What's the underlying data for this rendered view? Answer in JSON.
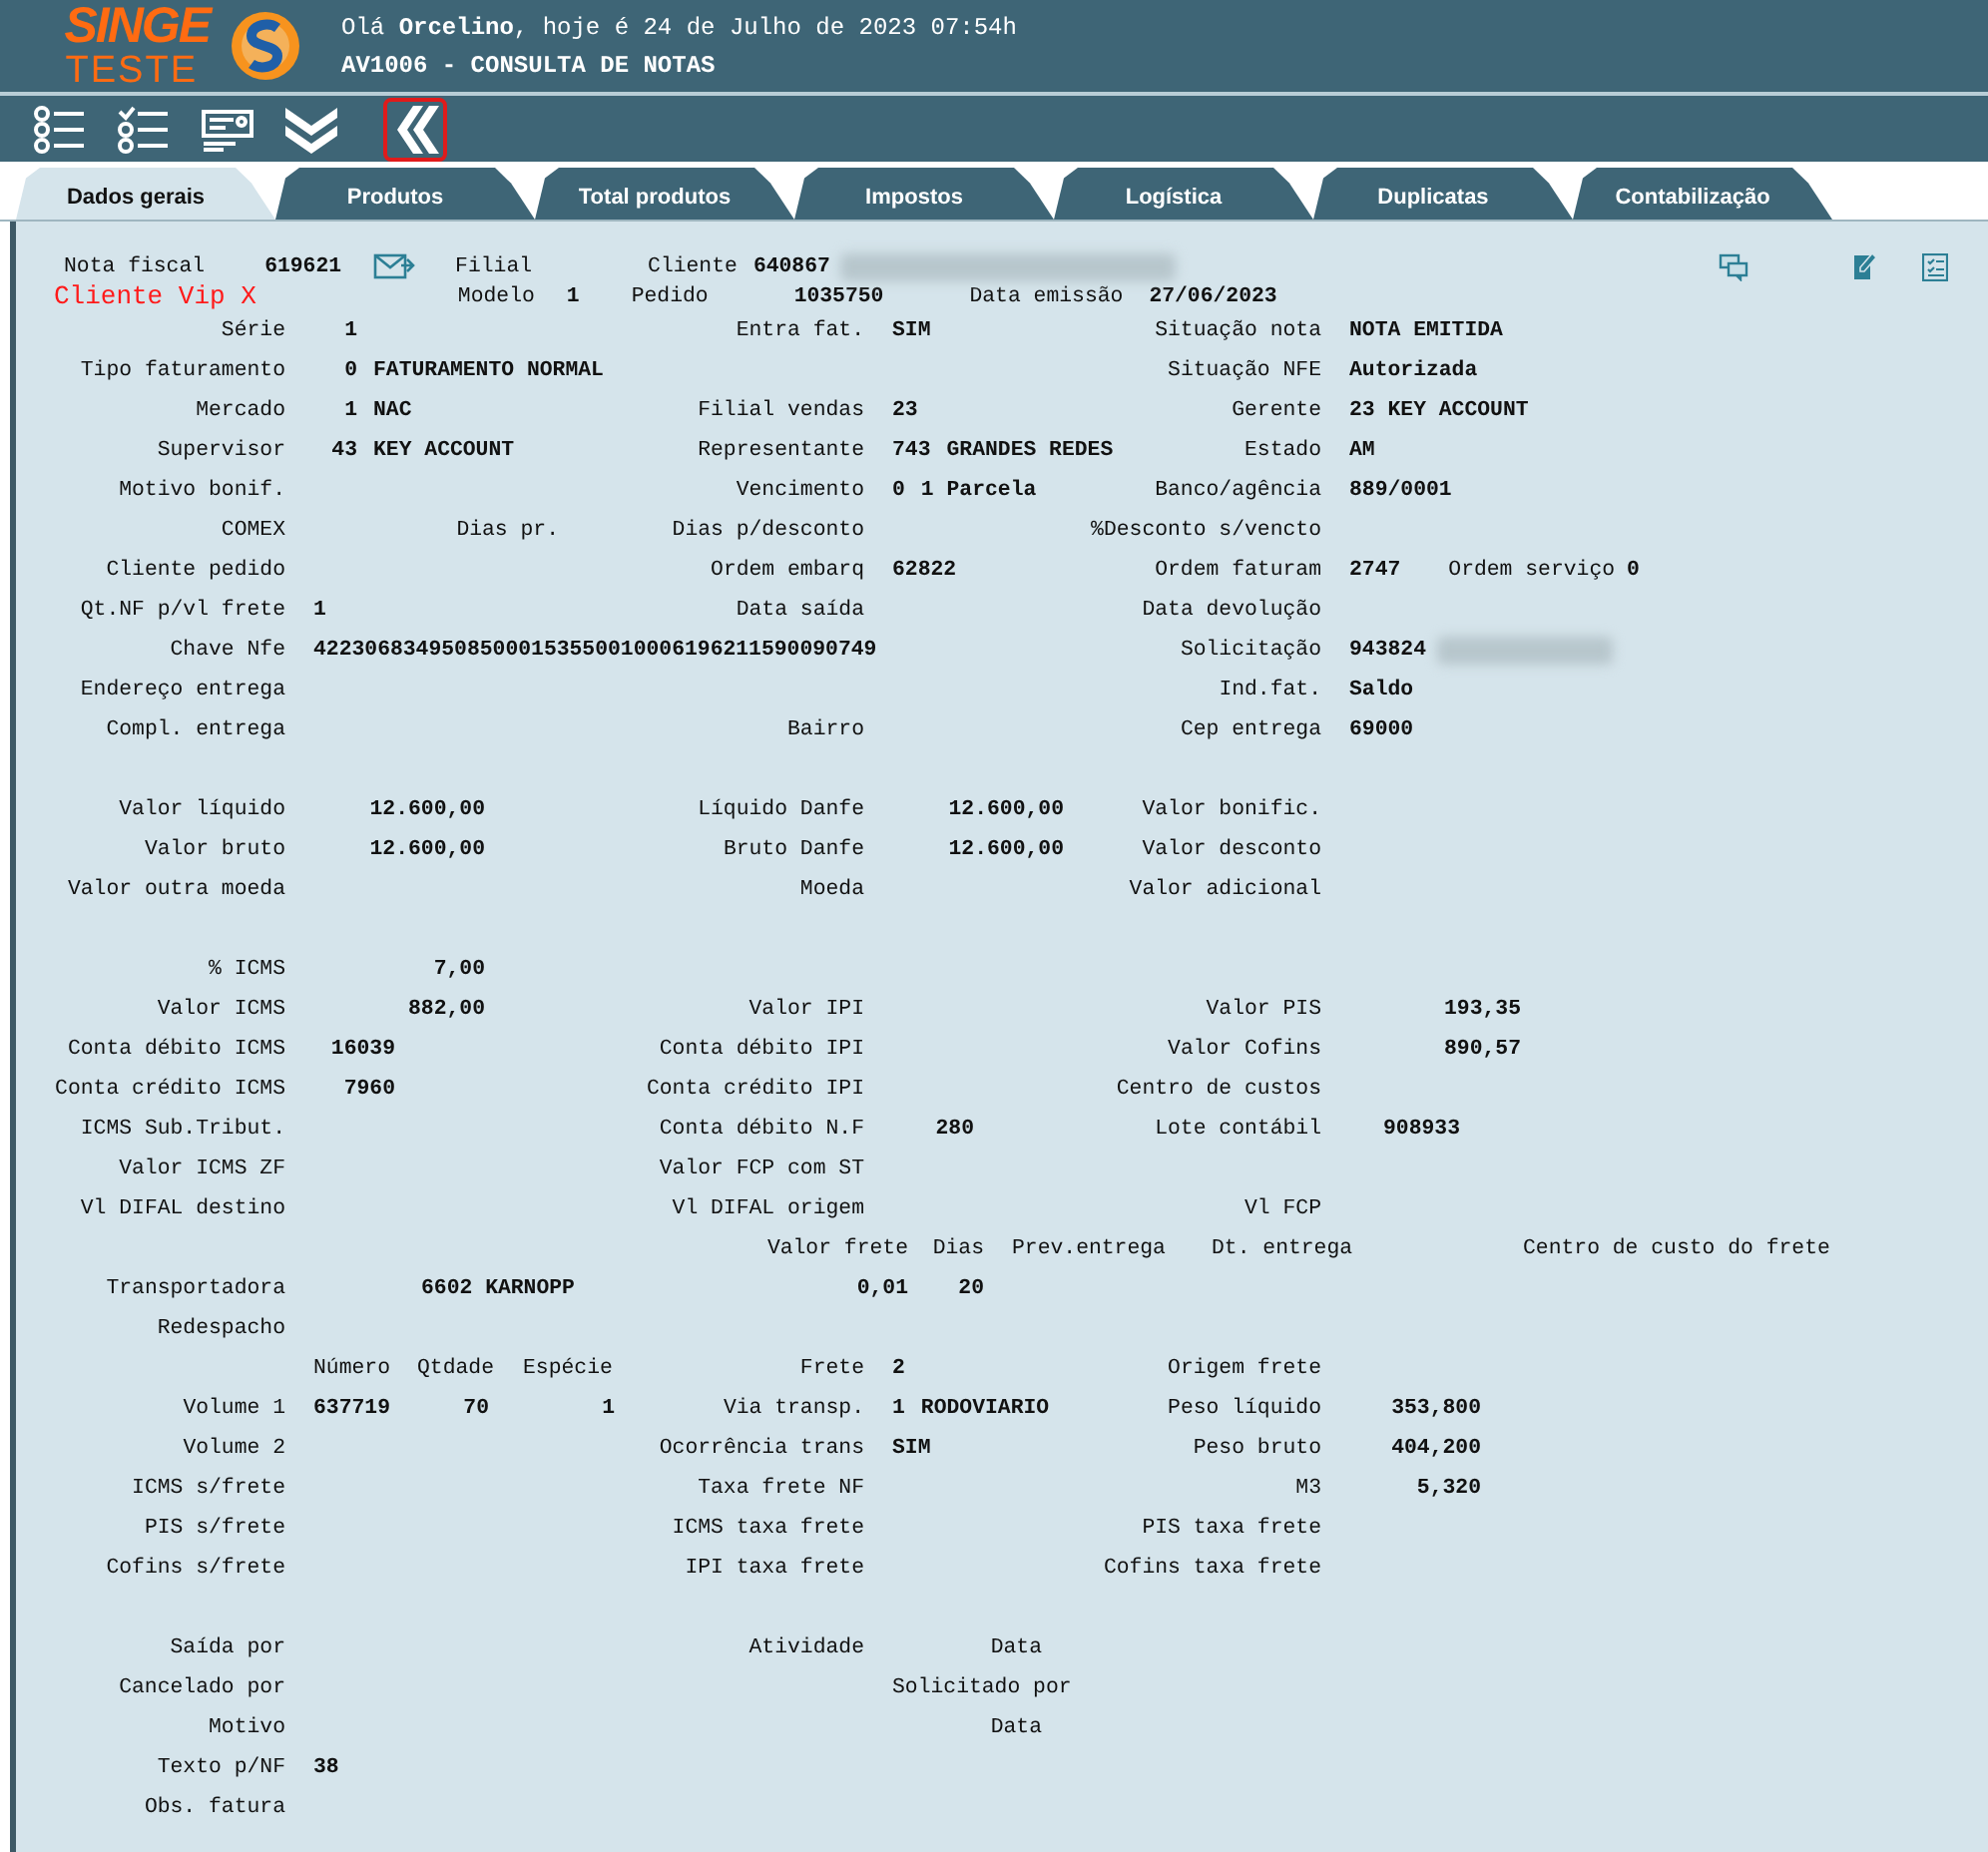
{
  "logo": {
    "name": "SINGE",
    "subtitle": "TESTE"
  },
  "greeting": "Olá **Orcelino**, hoje é 24 de Julho de 2023 07:54h",
  "title": "AV1006 - CONSULTA DE NOTAS",
  "toolbar": [
    {
      "kind": "list",
      "highlighted": false
    },
    {
      "kind": "checklist",
      "highlighted": false
    },
    {
      "kind": "card",
      "highlighted": false
    },
    {
      "kind": "chevrons-down",
      "highlighted": false
    },
    {
      "kind": "chevrons-left",
      "highlighted": true
    }
  ],
  "tabs": [
    {
      "label": "Dados gerais",
      "selected": true
    },
    {
      "label": "Produtos",
      "selected": false
    },
    {
      "label": "Total produtos",
      "selected": false
    },
    {
      "label": "Impostos",
      "selected": false
    },
    {
      "label": "Logística",
      "selected": false
    },
    {
      "label": "Duplicatas",
      "selected": false
    },
    {
      "label": "Contabilização",
      "selected": false
    }
  ],
  "header": {
    "nota_fiscal": {
      "label": "Nota fiscal",
      "value": "619621"
    },
    "filial": {
      "label": "Filial"
    },
    "cliente": {
      "label": "Cliente",
      "value": "640867",
      "redacted": true
    },
    "vip": "Cliente Vip X",
    "modelo": {
      "label": "Modelo",
      "value": "1"
    },
    "pedido": {
      "label": "Pedido",
      "value": "1035750"
    },
    "data_emissao": {
      "label": "Data emissão",
      "value": "27/06/2023"
    }
  },
  "sections": [
    {
      "rows": [
        {
          "cells": [
            {
              "label": "Série",
              "value": [
                "1"
              ]
            },
            {
              "label": "Entra fat.",
              "value": "SIM"
            },
            {
              "label": "Situação nota",
              "value": "NOTA EMITIDA"
            }
          ]
        },
        {
          "cells": [
            {
              "label": "Tipo faturamento",
              "value": [
                "0",
                "FATURAMENTO NORMAL"
              ]
            },
            null,
            {
              "label": "Situação NFE",
              "value": "Autorizada"
            }
          ]
        },
        {
          "cells": [
            {
              "label": "Mercado",
              "value": [
                "1",
                "NAC"
              ]
            },
            {
              "label": "Filial vendas",
              "value": "23"
            },
            {
              "label": "Gerente",
              "value": "23 KEY ACCOUNT"
            }
          ]
        },
        {
          "cells": [
            {
              "label": "Supervisor",
              "value": [
                "43",
                "KEY ACCOUNT"
              ]
            },
            {
              "label": "Representante",
              "value": [
                "743",
                "GRANDES REDES"
              ]
            },
            {
              "label": "Estado",
              "value": "AM"
            }
          ]
        },
        {
          "cells": [
            {
              "label": "Motivo bonif."
            },
            {
              "label": "Vencimento",
              "value": [
                "0",
                "1 Parcela"
              ]
            },
            {
              "label": "Banco/agência",
              "value": "889/0001"
            }
          ]
        },
        {
          "cells": [
            {
              "label": "COMEX",
              "note": "Dias pr."
            },
            {
              "label": "Dias p/desconto"
            },
            {
              "label": "%Desconto s/vencto"
            }
          ]
        },
        {
          "cells": [
            {
              "label": "Cliente pedido"
            },
            {
              "label": "Ordem embarq",
              "value": "62822"
            },
            {
              "label": "Ordem faturam",
              "value": "2747",
              "extra": {
                "label": "Ordem serviço",
                "value": "0"
              }
            }
          ]
        },
        {
          "cells": [
            {
              "label": "Qt.NF p/vl frete",
              "value": "1"
            },
            {
              "label": "Data saída"
            },
            {
              "label": "Data devolução"
            }
          ]
        },
        {
          "cells": [
            {
              "label": "Chave Nfe",
              "value": "42230683495085000153550010006196211590090749"
            },
            null,
            {
              "label": "Solicitação",
              "value": "943824",
              "redacted": true
            }
          ]
        },
        {
          "cells": [
            {
              "label": "Endereço entrega"
            },
            null,
            {
              "label": "Ind.fat.",
              "value": "Saldo"
            }
          ]
        },
        {
          "cells": [
            {
              "label": "Compl. entrega"
            },
            {
              "label": "Bairro"
            },
            {
              "label": "Cep entrega",
              "value": "69000"
            }
          ]
        }
      ]
    },
    {
      "rows": [
        {
          "cells": [
            {
              "label": "Valor líquido",
              "value": "12.600,00",
              "kind": "amount"
            },
            {
              "label": "Líquido Danfe",
              "value": "12.600,00",
              "kind": "amount"
            },
            {
              "label": "Valor bonific."
            }
          ]
        },
        {
          "cells": [
            {
              "label": "Valor bruto",
              "value": "12.600,00",
              "kind": "amount"
            },
            {
              "label": "Bruto Danfe",
              "value": "12.600,00",
              "kind": "amount"
            },
            {
              "label": "Valor desconto"
            }
          ]
        },
        {
          "cells": [
            {
              "label": "Valor outra moeda"
            },
            {
              "label": "Moeda"
            },
            {
              "label": "Valor adicional"
            }
          ]
        }
      ]
    },
    {
      "rows": [
        {
          "cells": [
            {
              "label": "% ICMS",
              "value": "7,00",
              "kind": "amount"
            },
            null,
            null
          ]
        },
        {
          "cells": [
            {
              "label": "Valor ICMS",
              "value": "882,00",
              "kind": "amount"
            },
            {
              "label": "Valor IPI"
            },
            {
              "label": "Valor PIS",
              "value": "193,35",
              "kind": "amount"
            }
          ]
        },
        {
          "cells": [
            {
              "label": "Conta débito ICMS",
              "value": "16039",
              "kind": "code"
            },
            {
              "label": "Conta débito IPI"
            },
            {
              "label": "Valor Cofins",
              "value": "890,57",
              "kind": "amount"
            }
          ]
        },
        {
          "cells": [
            {
              "label": "Conta crédito ICMS",
              "value": "7960",
              "kind": "code"
            },
            {
              "label": "Conta crédito IPI"
            },
            {
              "label": "Centro de custos"
            }
          ]
        },
        {
          "cells": [
            {
              "label": "ICMS Sub.Tribut."
            },
            {
              "label": "Conta débito N.F",
              "value": "280",
              "kind": "code"
            },
            {
              "label": "Lote contábil",
              "value": "908933",
              "kind": "lot"
            }
          ]
        },
        {
          "cells": [
            {
              "label": "Valor ICMS ZF"
            },
            {
              "label": "Valor FCP com ST"
            },
            null
          ]
        },
        {
          "cells": [
            {
              "label": "Vl DIFAL destino"
            },
            {
              "label": "Vl DIFAL origem"
            },
            {
              "label": "Vl FCP"
            }
          ]
        },
        {
          "kind": "freight_head",
          "columns": [
            "Valor frete",
            "Dias",
            "Prev.entrega",
            "Dt. entrega",
            "Centro de custo do frete"
          ]
        },
        {
          "kind": "carrier",
          "label": "Transportadora",
          "value": "6602 KARNOPP",
          "freight": "0,01",
          "days": "20"
        },
        {
          "cells": [
            {
              "label": "Redespacho"
            },
            null,
            null
          ]
        },
        {
          "cells": [
            {
              "columns": [
                "Número",
                "Qtdade",
                "Espécie"
              ]
            },
            {
              "label": "Frete",
              "value": "2"
            },
            {
              "label": "Origem frete"
            }
          ]
        },
        {
          "cells": [
            {
              "label": "Volume 1",
              "value": [
                "637719",
                "70",
                "1"
              ],
              "kind": "volume"
            },
            {
              "label": "Via transp.",
              "value": [
                "1",
                "RODOVIARIO"
              ]
            },
            {
              "label": "Peso líquido",
              "value": "353,800",
              "kind": "weight"
            }
          ]
        },
        {
          "cells": [
            {
              "label": "Volume 2"
            },
            {
              "label": "Ocorrência trans",
              "value": "SIM"
            },
            {
              "label": "Peso bruto",
              "value": "404,200",
              "kind": "weight"
            }
          ]
        },
        {
          "cells": [
            {
              "label": "ICMS s/frete"
            },
            {
              "label": "Taxa frete NF"
            },
            {
              "label": "M3",
              "value": "5,320",
              "kind": "weight"
            }
          ]
        },
        {
          "cells": [
            {
              "label": "PIS s/frete"
            },
            {
              "label": "ICMS taxa frete"
            },
            {
              "label": "PIS taxa frete"
            }
          ]
        },
        {
          "cells": [
            {
              "label": "Cofins s/frete"
            },
            {
              "label": "IPI taxa frete"
            },
            {
              "label": "Cofins taxa frete"
            }
          ]
        }
      ]
    },
    {
      "rows": [
        {
          "cells": [
            {
              "label": "Saída por"
            },
            {
              "label": "Atividade",
              "note": "Data"
            },
            null
          ]
        },
        {
          "cells": [
            {
              "label": "Cancelado por"
            },
            {
              "note": "Solicitado por"
            },
            null
          ]
        },
        {
          "cells": [
            {
              "label": "Motivo"
            },
            {
              "note": "Data"
            },
            null
          ]
        },
        {
          "cells": [
            {
              "label": "Texto p/NF",
              "value": "38"
            },
            null,
            null
          ]
        },
        {
          "cells": [
            {
              "label": "Obs. fatura"
            },
            null,
            null
          ]
        }
      ]
    }
  ]
}
